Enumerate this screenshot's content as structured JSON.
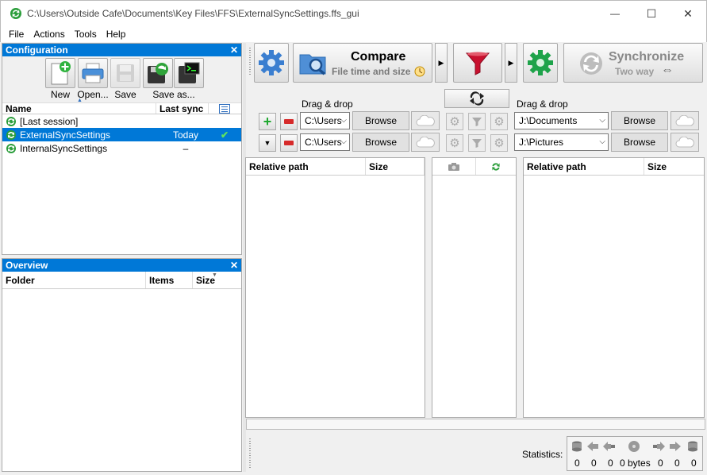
{
  "window": {
    "title": "C:\\Users\\Outside Cafe\\Documents\\Key Files\\FFS\\ExternalSyncSettings.ffs_gui",
    "minimize": "—",
    "maximize": "☐",
    "close": "✕"
  },
  "menu": [
    "File",
    "Actions",
    "Tools",
    "Help"
  ],
  "configuration": {
    "header": "Configuration",
    "close": "✕",
    "toolbar": {
      "new": "New",
      "open": "Open...",
      "save": "Save",
      "save_as": "Save as..."
    },
    "columns": {
      "name": "Name",
      "last_sync": "Last sync"
    },
    "rows": [
      {
        "name": "[Last session]",
        "last_sync": "",
        "check": ""
      },
      {
        "name": "ExternalSyncSettings",
        "last_sync": "Today",
        "check": "✔"
      },
      {
        "name": "InternalSyncSettings",
        "last_sync": "–",
        "check": ""
      }
    ]
  },
  "overview": {
    "header": "Overview",
    "close": "✕",
    "columns": {
      "folder": "Folder",
      "items": "Items",
      "size": "Size"
    }
  },
  "compare": {
    "title": "Compare",
    "subtitle": "File time and size"
  },
  "synchronize": {
    "title": "Synchronize",
    "subtitle": "Two way",
    "arrow": "⇔"
  },
  "folders": {
    "left_label": "Drag & drop",
    "right_label": "Drag & drop",
    "left_pairs": [
      "C:\\Users",
      "C:\\Users"
    ],
    "right_pairs": [
      "J:\\Documents",
      "J:\\Pictures"
    ],
    "browse": "Browse",
    "add": "+",
    "remove": "−",
    "expand": "▼"
  },
  "grid": {
    "left": {
      "relative_path": "Relative path",
      "size": "Size"
    },
    "right": {
      "relative_path": "Relative path",
      "size": "Size"
    }
  },
  "statistics": {
    "label": "Statistics:",
    "values": [
      "0",
      "0",
      "0",
      "0 bytes",
      "0",
      "0",
      "0"
    ]
  },
  "colors": {
    "accent": "#0078d7",
    "sync_green": "#29a83a",
    "filter_red": "#c8102e",
    "gear_blue": "#3a7ed0",
    "gear_green": "#1ea34a"
  }
}
